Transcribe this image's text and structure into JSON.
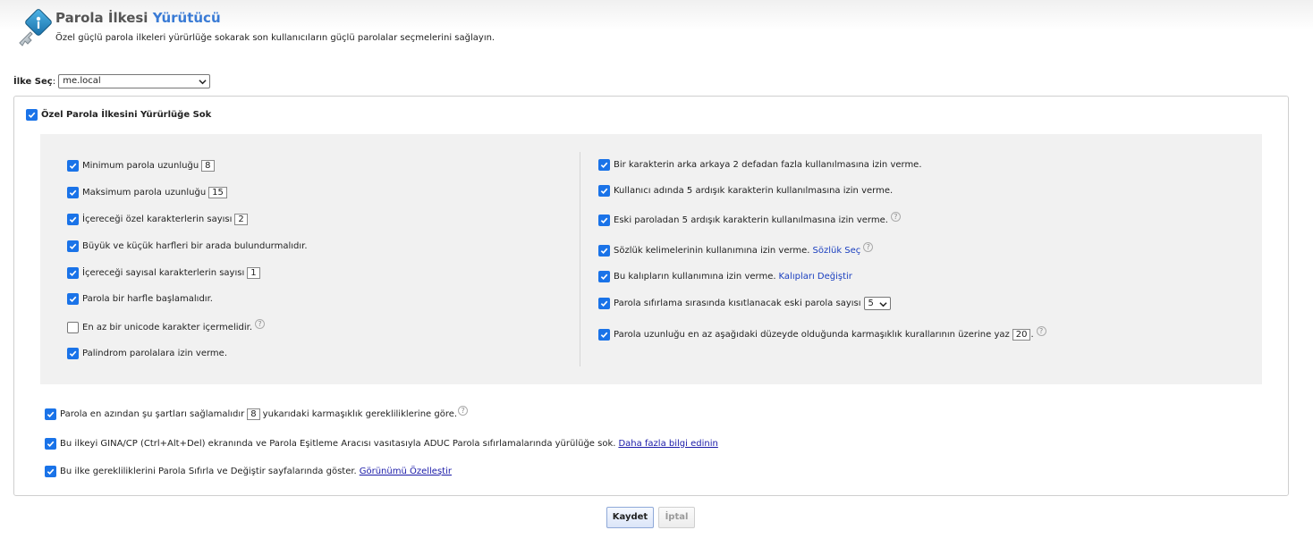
{
  "header": {
    "title_main": "Parola İlkesi",
    "title_accent": "Yürütücü",
    "subtitle": "Özel güçlü parola ilkeleri yürürlüğe sokarak son kullanıcıların güçlü parolalar seçmelerini sağlayın."
  },
  "policy_select": {
    "label": "İlke Seç",
    "colon": " : ",
    "value": "me.local"
  },
  "enforce": {
    "label": "Özel Parola İlkesini Yürürlüğe Sok",
    "checked": true
  },
  "left_rules": [
    {
      "label": "Minimum parola uzunluğu",
      "value": "8",
      "checked": true
    },
    {
      "label": "Maksimum parola uzunluğu",
      "value": "15",
      "checked": true
    },
    {
      "label": "İçereceği özel karakterlerin sayısı",
      "value": "2",
      "checked": true
    },
    {
      "label": "Büyük ve küçük harfleri bir arada bulundurmalıdır.",
      "checked": true
    },
    {
      "label": "İçereceği sayısal karakterlerin sayısı",
      "value": "1",
      "checked": true
    },
    {
      "label": "Parola bir harfle başlamalıdır.",
      "checked": true
    },
    {
      "label": "En az bir unicode karakter içermelidir.",
      "checked": false,
      "help": "?"
    },
    {
      "label": "Palindrom parolalara izin verme.",
      "checked": true
    }
  ],
  "right_rules": [
    {
      "label": "Bir karakterin arka arkaya 2 defadan fazla kullanılmasına izin verme.",
      "checked": true
    },
    {
      "label": "Kullanıcı adında 5 ardışık karakterin kullanılmasına izin verme.",
      "checked": true
    },
    {
      "label": "Eski paroladan 5 ardışık karakterin kullanılmasına izin verme.",
      "checked": true,
      "help": "?"
    },
    {
      "label": "Sözlük kelimelerinin kullanımına izin verme.",
      "link": "Sözlük Seç",
      "checked": true,
      "help": "?"
    },
    {
      "label": "Bu kalıpların kullanımına izin verme.",
      "link": "Kalıpları Değiştir",
      "checked": true
    },
    {
      "label": "Parola sıfırlama sırasında kısıtlanacak eski parola sayısı",
      "select_value": "5",
      "checked": true
    },
    {
      "label": "Parola uzunluğu en az aşağıdaki düzeyde olduğunda karmaşıklık kurallarının üzerine yaz",
      "value": "20",
      "suffix": ".",
      "checked": true,
      "help": "?"
    }
  ],
  "bottom_rules": [
    {
      "label_before": "Parola en azından şu şartları sağlamalıdır",
      "value": "8",
      "label_after": "yukarıdaki karmaşıklık gerekliliklerine göre.",
      "checked": true,
      "help": "?"
    },
    {
      "label": "Bu ilkeyi GINA/CP (Ctrl+Alt+Del) ekranında ve Parola Eşitleme Aracısı vasıtasıyla ADUC Parola sıfırlamalarında yürülüğe sok.",
      "link": "Daha fazla bilgi edinin",
      "checked": true
    },
    {
      "label": "Bu ilke gerekliliklerini Parola Sıfırla ve Değiştir sayfalarında göster.",
      "link": "Görünümü Özelleştir",
      "checked": true
    }
  ],
  "buttons": {
    "save": "Kaydet",
    "cancel": "İptal"
  },
  "colors": {
    "accent": "#3a7bd5",
    "checkbox": "#1a73e8",
    "link": "#1a3fbf"
  }
}
